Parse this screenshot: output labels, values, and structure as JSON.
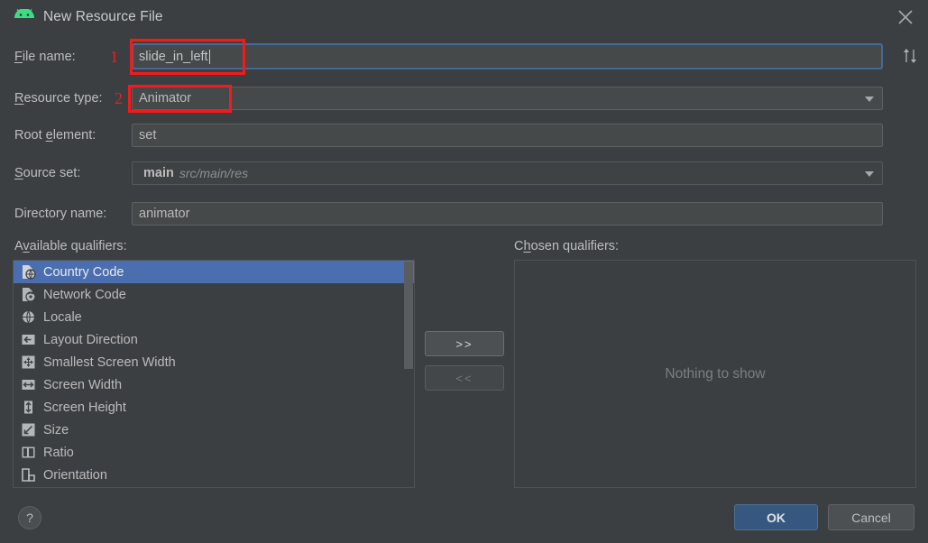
{
  "window": {
    "title": "New Resource File",
    "app_icon": "android-icon",
    "close_icon": "close-icon",
    "background_color": "#3c3f41",
    "accent_color": "#4b6eaf",
    "annotation_color": "#f51a1a"
  },
  "form": {
    "file_name": {
      "label": "File name:",
      "mnemonic": "F",
      "value": "slide_in_left",
      "focused": true
    },
    "resource_type": {
      "label": "Resource type:",
      "mnemonic": "R",
      "value": "Animator",
      "type": "dropdown"
    },
    "root_element": {
      "label": "Root element:",
      "mnemonic": "e",
      "value": "set",
      "type": "text"
    },
    "source_set": {
      "label": "Source set:",
      "mnemonic": "S",
      "value": "main",
      "value_secondary": "src/main/res",
      "type": "dropdown"
    },
    "directory_name": {
      "label": "Directory name:",
      "mnemonic": "",
      "value": "animator",
      "type": "text"
    },
    "sort_icon": "sort-up-down-icon"
  },
  "annotations": [
    {
      "number": "1",
      "target": "file-name-field"
    },
    {
      "number": "2",
      "target": "resource-type-field"
    }
  ],
  "qualifiers": {
    "available_label": "Available qualifiers:",
    "available_mnemonic": "v",
    "chosen_label": "Chosen qualifiers:",
    "chosen_mnemonic": "h",
    "available_items": [
      {
        "label": "Country Code",
        "icon": "country-code-icon",
        "selected": true
      },
      {
        "label": "Network Code",
        "icon": "network-code-icon",
        "selected": false
      },
      {
        "label": "Locale",
        "icon": "globe-icon",
        "selected": false
      },
      {
        "label": "Layout Direction",
        "icon": "arrow-left-icon",
        "selected": false
      },
      {
        "label": "Smallest Screen Width",
        "icon": "four-way-arrows-icon",
        "selected": false
      },
      {
        "label": "Screen Width",
        "icon": "arrow-horizontal-icon",
        "selected": false
      },
      {
        "label": "Screen Height",
        "icon": "arrow-vertical-icon",
        "selected": false
      },
      {
        "label": "Size",
        "icon": "diagonal-arrow-icon",
        "selected": false
      },
      {
        "label": "Ratio",
        "icon": "ratio-icon",
        "selected": false
      },
      {
        "label": "Orientation",
        "icon": "orientation-icon",
        "selected": false
      }
    ],
    "chosen_empty_text": "Nothing to show",
    "add_button": ">>",
    "remove_button": "<<"
  },
  "footer": {
    "help_label": "?",
    "ok_label": "OK",
    "cancel_label": "Cancel"
  }
}
